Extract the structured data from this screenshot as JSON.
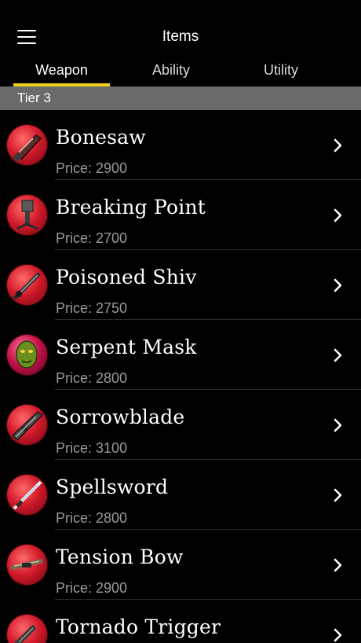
{
  "header": {
    "title": "Items",
    "menu_icon": "hamburger-menu-icon"
  },
  "tabs": [
    {
      "label": "Weapon",
      "active": true
    },
    {
      "label": "Ability",
      "active": false
    },
    {
      "label": "Utility",
      "active": false
    }
  ],
  "tab_accent_color": "#f0cf1e",
  "section": {
    "label": "Tier 3"
  },
  "items": [
    {
      "name": "Bonesaw",
      "price": "Price: 2900",
      "icon": "bonesaw-icon"
    },
    {
      "name": "Breaking Point",
      "price": "Price: 2700",
      "icon": "breaking-point-icon"
    },
    {
      "name": "Poisoned Shiv",
      "price": "Price: 2750",
      "icon": "poisoned-shiv-icon"
    },
    {
      "name": "Serpent Mask",
      "price": "Price: 2800",
      "icon": "serpent-mask-icon"
    },
    {
      "name": "Sorrowblade",
      "price": "Price: 3100",
      "icon": "sorrowblade-icon"
    },
    {
      "name": "Spellsword",
      "price": "Price: 2800",
      "icon": "spellsword-icon"
    },
    {
      "name": "Tension Bow",
      "price": "Price: 2900",
      "icon": "tension-bow-icon"
    },
    {
      "name": "Tornado Trigger",
      "price": "",
      "icon": "tornado-trigger-icon"
    }
  ]
}
